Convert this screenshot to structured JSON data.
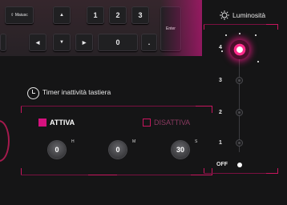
{
  "keyboard": {
    "keys": [
      {
        "label": "⇧ Maiusc",
        "name": "key-shift"
      },
      {
        "label": "▲",
        "name": "key-up-arrow"
      },
      {
        "label": "1",
        "name": "key-1"
      },
      {
        "label": "2",
        "name": "key-2"
      },
      {
        "label": "3",
        "name": "key-3"
      },
      {
        "label": "Enter",
        "name": "key-enter"
      },
      {
        "label": "◀",
        "name": "key-left-arrow"
      },
      {
        "label": "▼",
        "name": "key-down-arrow"
      },
      {
        "label": "▶",
        "name": "key-right-arrow"
      },
      {
        "label": "0",
        "name": "key-0"
      },
      {
        "label": ".",
        "name": "key-dot"
      }
    ]
  },
  "timer": {
    "title": "Timer inattività tastiera",
    "on_label": "ATTIVA",
    "off_label": "DISATTIVA",
    "selected": "ATTIVA",
    "hours": {
      "value": "0",
      "unit": "H"
    },
    "minutes": {
      "value": "0",
      "unit": "M"
    },
    "seconds": {
      "value": "30",
      "unit": "S"
    }
  },
  "luminosity": {
    "title": "Luminosità",
    "levels": [
      "4",
      "3",
      "2",
      "1",
      "OFF"
    ],
    "selected_level": "4"
  },
  "colors": {
    "accent": "#d5117e",
    "frame": "#c8155e",
    "background": "#151516"
  }
}
